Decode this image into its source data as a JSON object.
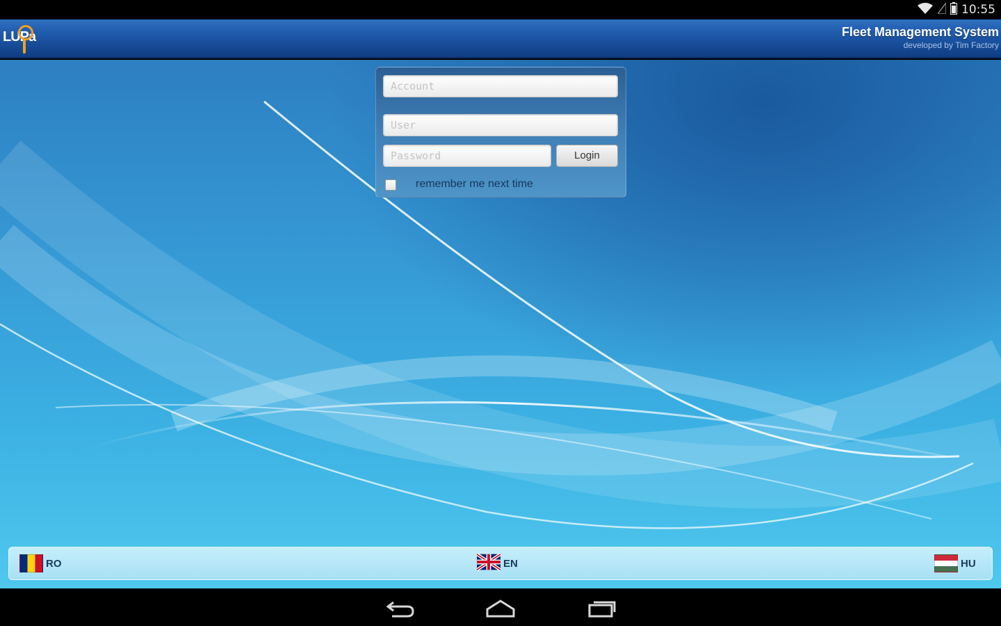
{
  "status_bar": {
    "time": "10:55",
    "icons": [
      "wifi-icon",
      "signal-icon",
      "battery-icon"
    ]
  },
  "header": {
    "logo_text": "LUPa",
    "title": "Fleet Management System",
    "subtitle": "developed by Tim Factory"
  },
  "login": {
    "account_placeholder": "Account",
    "user_placeholder": "User",
    "password_placeholder": "Password",
    "login_label": "Login",
    "remember_label": "remember me next time",
    "remember_checked": false
  },
  "languages": [
    {
      "code": "RO",
      "flag": "romania-flag-icon"
    },
    {
      "code": "EN",
      "flag": "uk-flag-icon"
    },
    {
      "code": "HU",
      "flag": "hungary-flag-icon"
    }
  ],
  "nav": {
    "buttons": [
      "back-icon",
      "home-icon",
      "recent-apps-icon"
    ]
  },
  "colors": {
    "header_blue": "#1d56a6",
    "background_blue": "#3598d4",
    "language_bar": "#b8e8f8"
  }
}
